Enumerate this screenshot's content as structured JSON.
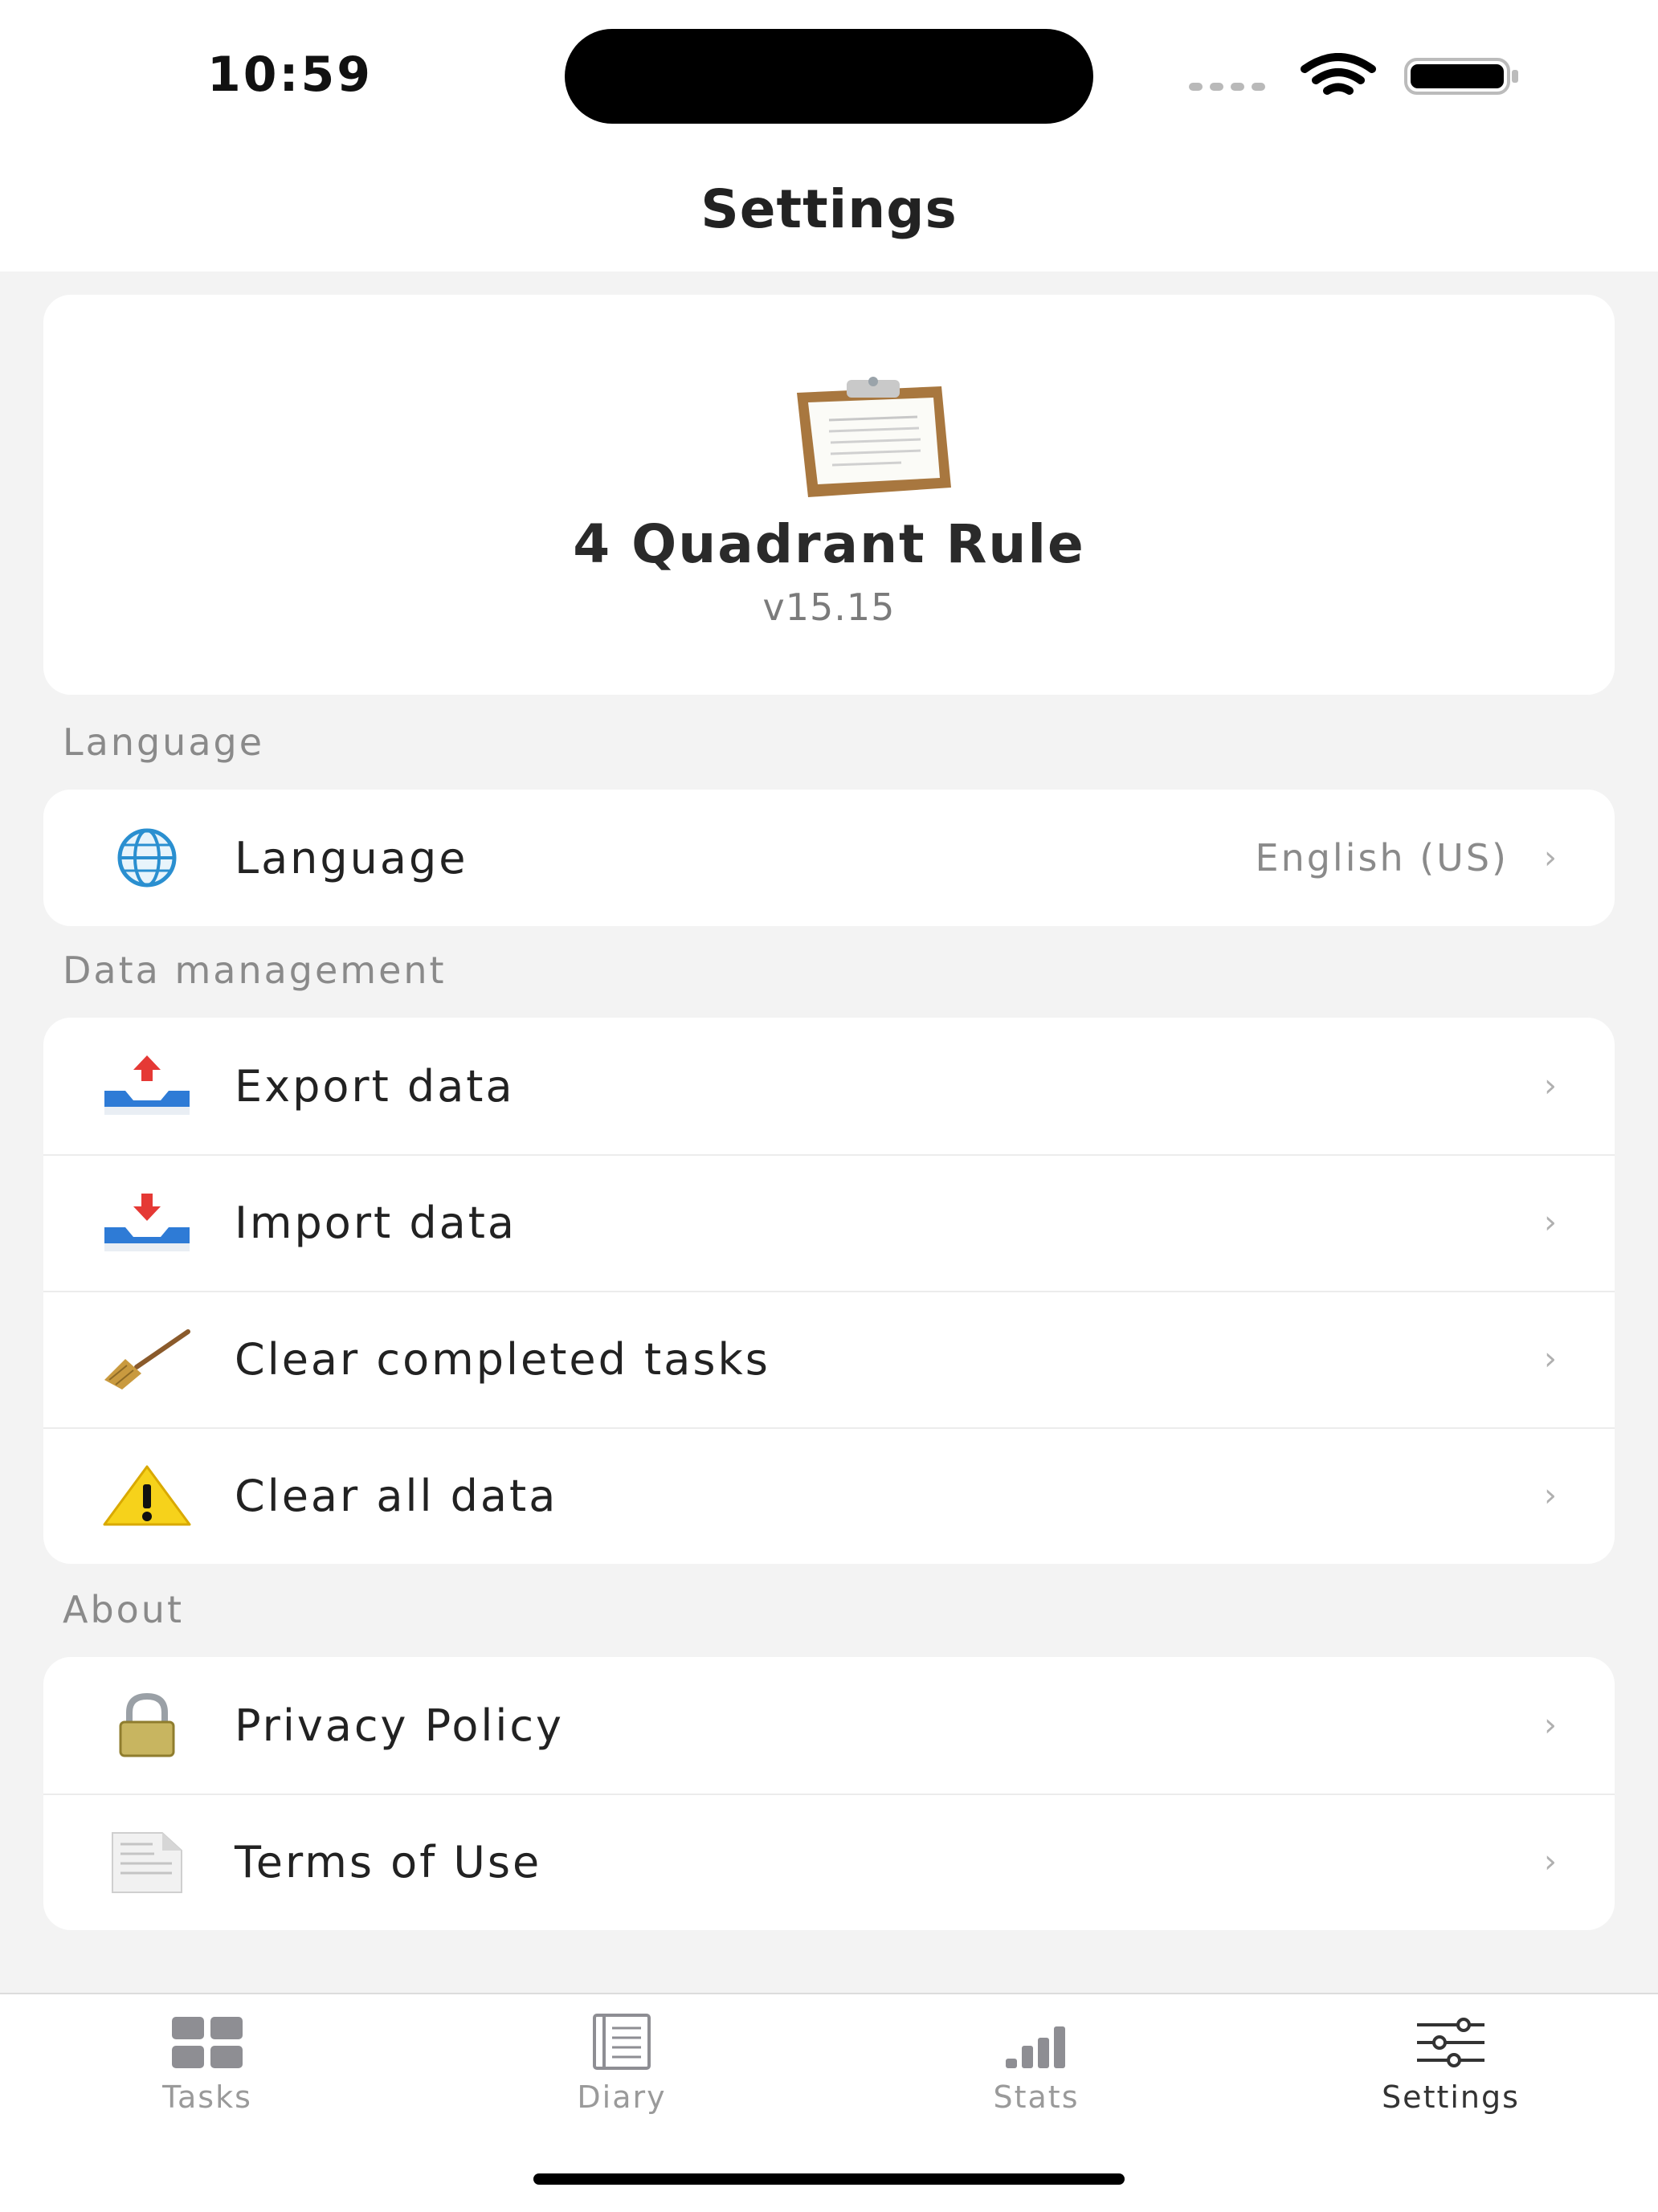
{
  "status_bar": {
    "time": "10:59"
  },
  "nav": {
    "title": "Settings"
  },
  "app_info": {
    "name": "4 Quadrant Rule",
    "version": "v15.15"
  },
  "sections": {
    "language": {
      "header": "Language",
      "items": [
        {
          "label": "Language",
          "value": "English (US)",
          "icon": "globe-icon"
        }
      ]
    },
    "data_management": {
      "header": "Data management",
      "items": [
        {
          "label": "Export data",
          "icon": "export-tray-icon"
        },
        {
          "label": "Import data",
          "icon": "import-tray-icon"
        },
        {
          "label": "Clear completed tasks",
          "icon": "broom-icon"
        },
        {
          "label": "Clear all data",
          "icon": "warning-icon"
        }
      ]
    },
    "about": {
      "header": "About",
      "items": [
        {
          "label": "Privacy Policy",
          "icon": "padlock-icon"
        },
        {
          "label": "Terms of Use",
          "icon": "document-icon"
        }
      ]
    }
  },
  "tab_bar": {
    "active": "Settings",
    "tabs": [
      {
        "label": "Tasks",
        "icon": "grid-icon"
      },
      {
        "label": "Diary",
        "icon": "notebook-icon"
      },
      {
        "label": "Stats",
        "icon": "bar-chart-icon"
      },
      {
        "label": "Settings",
        "icon": "sliders-icon"
      }
    ]
  },
  "colors": {
    "background": "#f3f3f3",
    "card": "#ffffff",
    "secondary_text": "#8a8a8a",
    "accent_red": "#e53935",
    "tray_blue": "#2e7bd6"
  }
}
